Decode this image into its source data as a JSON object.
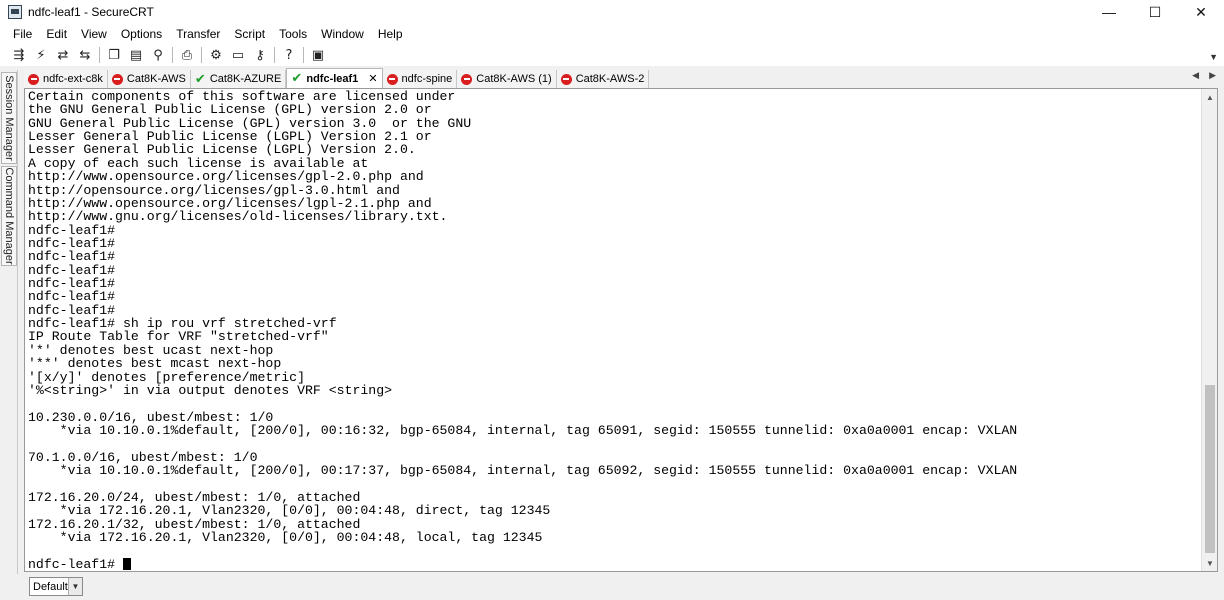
{
  "window": {
    "title": "ndfc-leaf1 - SecureCRT",
    "minimize": "—",
    "maximize": "☐",
    "close": "✕"
  },
  "menu": [
    "File",
    "Edit",
    "View",
    "Options",
    "Transfer",
    "Script",
    "Tools",
    "Window",
    "Help"
  ],
  "toolbar": {
    "icons": [
      "connect-icon",
      "quick-connect-icon",
      "reconnect-icon",
      "disconnect-icon",
      "copy-icon",
      "paste-icon",
      "find-icon",
      "print-icon",
      "settings-icon",
      "global-options-icon",
      "keymap-icon",
      "help-icon",
      "sftp-icon"
    ]
  },
  "sidebar": {
    "session_manager": "Session Manager",
    "command_manager": "Command Manager"
  },
  "tabs": [
    {
      "label": "ndfc-ext-c8k",
      "status": "disconnected"
    },
    {
      "label": "Cat8K-AWS",
      "status": "disconnected"
    },
    {
      "label": "Cat8K-AZURE",
      "status": "connected"
    },
    {
      "label": "ndfc-leaf1",
      "status": "connected",
      "active": true,
      "close": "✕"
    },
    {
      "label": "ndfc-spine",
      "status": "disconnected"
    },
    {
      "label": "Cat8K-AWS (1)",
      "status": "disconnected"
    },
    {
      "label": "Cat8K-AWS-2",
      "status": "disconnected"
    }
  ],
  "colors": {
    "disconnected": "#d81e1e",
    "connected": "#1f9d2a"
  },
  "terminal": {
    "lines": [
      "Certain components of this software are licensed under",
      "the GNU General Public License (GPL) version 2.0 or",
      "GNU General Public License (GPL) version 3.0  or the GNU",
      "Lesser General Public License (LGPL) Version 2.1 or",
      "Lesser General Public License (LGPL) Version 2.0.",
      "A copy of each such license is available at",
      "http://www.opensource.org/licenses/gpl-2.0.php and",
      "http://opensource.org/licenses/gpl-3.0.html and",
      "http://www.opensource.org/licenses/lgpl-2.1.php and",
      "http://www.gnu.org/licenses/old-licenses/library.txt.",
      "ndfc-leaf1#",
      "ndfc-leaf1#",
      "ndfc-leaf1#",
      "ndfc-leaf1#",
      "ndfc-leaf1#",
      "ndfc-leaf1#",
      "ndfc-leaf1#",
      "ndfc-leaf1# sh ip rou vrf stretched-vrf",
      "IP Route Table for VRF \"stretched-vrf\"",
      "'*' denotes best ucast next-hop",
      "'**' denotes best mcast next-hop",
      "'[x/y]' denotes [preference/metric]",
      "'%<string>' in via output denotes VRF <string>",
      "",
      "10.230.0.0/16, ubest/mbest: 1/0",
      "    *via 10.10.0.1%default, [200/0], 00:16:32, bgp-65084, internal, tag 65091, segid: 150555 tunnelid: 0xa0a0001 encap: VXLAN",
      "",
      "70.1.0.0/16, ubest/mbest: 1/0",
      "    *via 10.10.0.1%default, [200/0], 00:17:37, bgp-65084, internal, tag 65092, segid: 150555 tunnelid: 0xa0a0001 encap: VXLAN",
      "",
      "172.16.20.0/24, ubest/mbest: 1/0, attached",
      "    *via 172.16.20.1, Vlan2320, [0/0], 00:04:48, direct, tag 12345",
      "172.16.20.1/32, ubest/mbest: 1/0, attached",
      "    *via 172.16.20.1, Vlan2320, [0/0], 00:04:48, local, tag 12345",
      ""
    ],
    "prompt": "ndfc-leaf1# "
  },
  "statusbar": {
    "profile": "Default"
  }
}
